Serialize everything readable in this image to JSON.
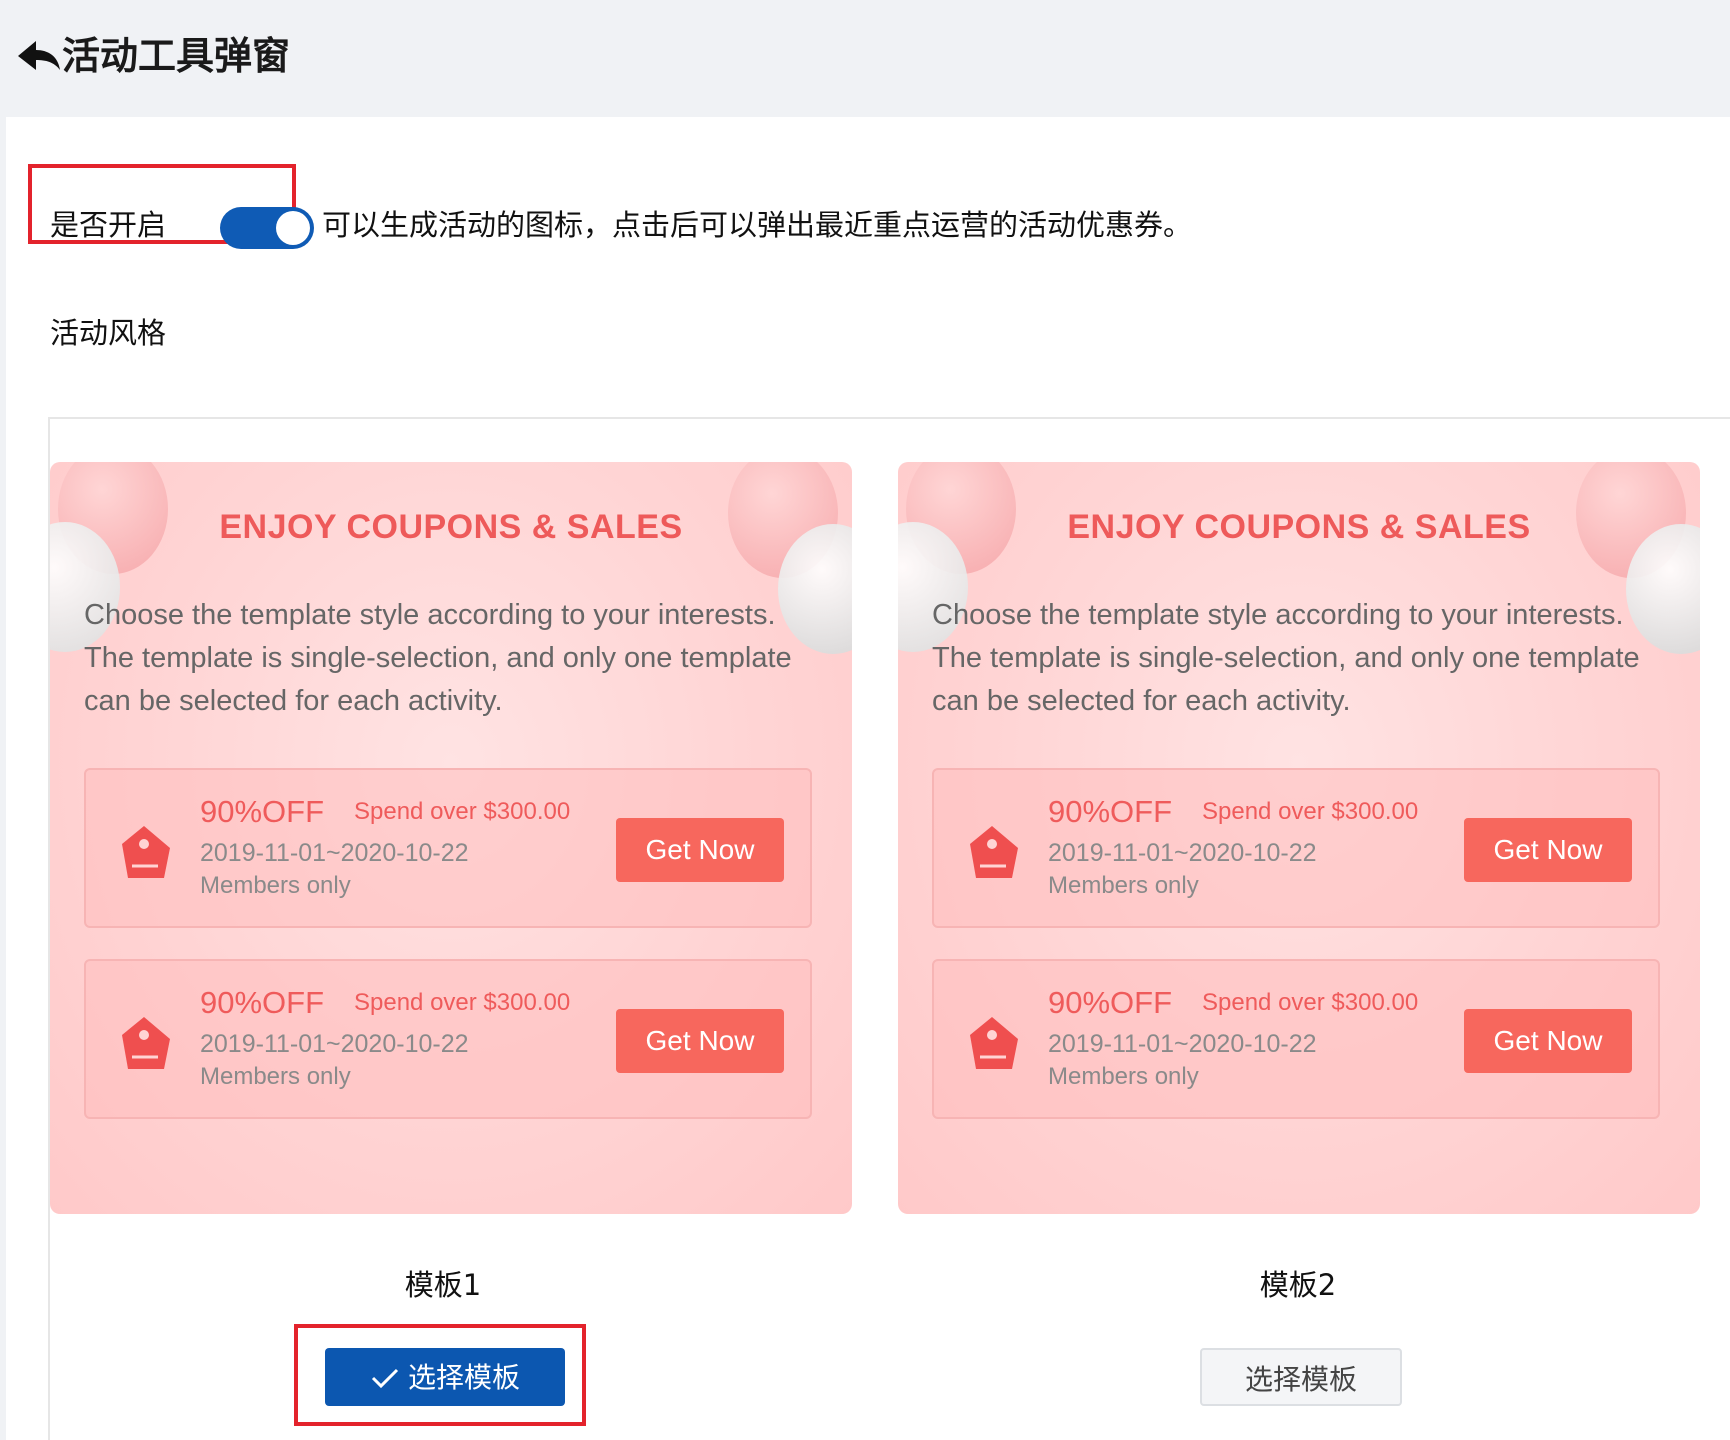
{
  "header": {
    "title": "活动工具弹窗",
    "back_icon": "back-arrow-icon"
  },
  "toggle_row": {
    "label": "是否开启",
    "enabled": true,
    "description": "可以生成活动的图标，点击后可以弹出最近重点运营的活动优惠券。"
  },
  "style_section": {
    "label": "活动风格"
  },
  "templates": [
    {
      "name": "模板1",
      "selected": true,
      "select_label": "选择模板",
      "preview": {
        "heading": "ENJOY COUPONS & SALES",
        "description": "Choose the template style according to your interests. The template is single-selection, and only one template can be selected for each activity.",
        "coupons": [
          {
            "discount": "90%OFF",
            "condition": "Spend over $300.00",
            "dates": "2019-11-01~2020-10-22",
            "audience": "Members only",
            "button": "Get Now"
          },
          {
            "discount": "90%OFF",
            "condition": "Spend over $300.00",
            "dates": "2019-11-01~2020-10-22",
            "audience": "Members only",
            "button": "Get Now"
          }
        ]
      }
    },
    {
      "name": "模板2",
      "selected": false,
      "select_label": "选择模板",
      "preview": {
        "heading": "ENJOY COUPONS & SALES",
        "description": "Choose the template style according to your interests. The template is single-selection, and only one template can be selected for each activity.",
        "coupons": [
          {
            "discount": "90%OFF",
            "condition": "Spend over $300.00",
            "dates": "2019-11-01~2020-10-22",
            "audience": "Members only",
            "button": "Get Now"
          },
          {
            "discount": "90%OFF",
            "condition": "Spend over $300.00",
            "dates": "2019-11-01~2020-10-22",
            "audience": "Members only",
            "button": "Get Now"
          }
        ]
      }
    }
  ],
  "colors": {
    "accent": "#0f5bb5",
    "highlight_border": "#e3232c",
    "coupon_red": "#f7675d",
    "template_bg": "#ffd4d4"
  }
}
